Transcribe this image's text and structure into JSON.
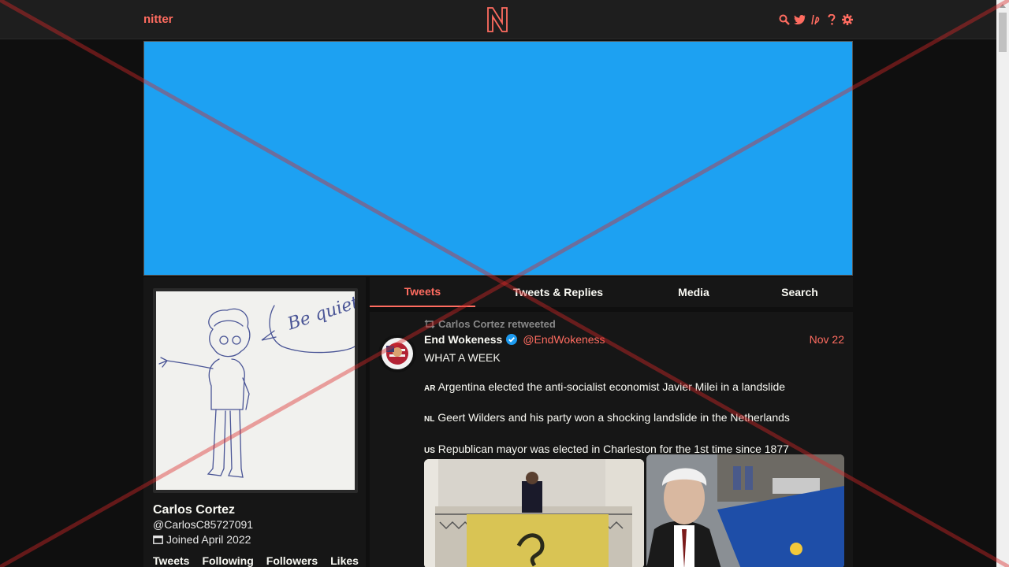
{
  "nav": {
    "brand": "nitter",
    "icons": [
      "search-icon",
      "twitter-bird-icon",
      "rss-icon",
      "help-icon",
      "gear-icon"
    ]
  },
  "colors": {
    "accent": "#ff6c60",
    "banner": "#1da1f2",
    "background": "#0f0f0f",
    "panel": "#161616"
  },
  "profile": {
    "fullname": "Carlos Cortez",
    "handle": "@CarlosC85727091",
    "joined": "Joined April 2022",
    "avatar_text": "Be quiet!",
    "stats": [
      "Tweets",
      "Following",
      "Followers",
      "Likes"
    ]
  },
  "tabs": [
    {
      "label": "Tweets",
      "active": true
    },
    {
      "label": "Tweets & Replies",
      "active": false
    },
    {
      "label": "Media",
      "active": false
    },
    {
      "label": "Search",
      "active": false
    }
  ],
  "tweet": {
    "retweet_header": "Carlos Cortez retweeted",
    "fullname": "End Wokeness",
    "verified": true,
    "username": "@EndWokeness",
    "date": "Nov 22",
    "lines": [
      {
        "code": "",
        "text": "WHAT A WEEK"
      },
      {
        "code": "AR",
        "text": "Argentina elected the anti-socialist economist Javier Milei in a landslide"
      },
      {
        "code": "NL",
        "text": "Geert Wilders and his party won a shocking landslide in the Netherlands"
      },
      {
        "code": "US",
        "text": "Republican mayor was elected in Charleston for the 1st time since 1877"
      }
    ]
  }
}
